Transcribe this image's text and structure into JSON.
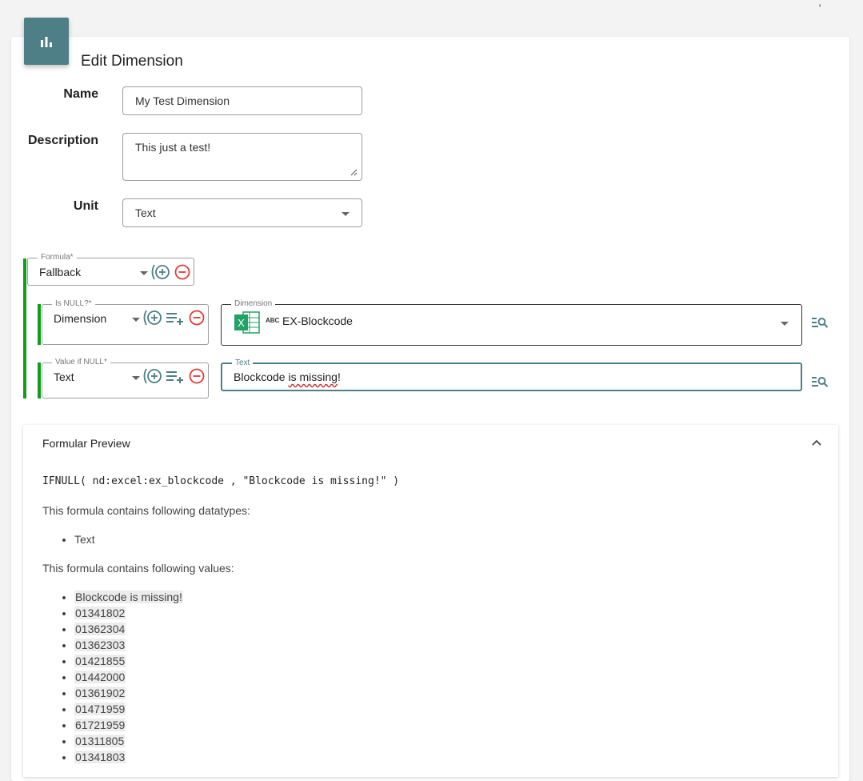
{
  "header": {
    "title": "Edit Dimension"
  },
  "form": {
    "name_label": "Name",
    "name_value": "My Test Dimension",
    "description_label": "Description",
    "description_value": "This just a test!",
    "unit_label": "Unit",
    "unit_value": "Text"
  },
  "formula": {
    "legend": "Formula*",
    "value": "Fallback",
    "isnull": {
      "legend": "Is NULL?*",
      "value": "Dimension",
      "dimension_legend": "Dimension",
      "dimension_type_badge": "ABC",
      "dimension_value": "EX-Blockcode",
      "excel_letter": "X"
    },
    "value_if_null": {
      "legend": "Value if NULL*",
      "value": "Text",
      "text_legend": "Text",
      "text_value": "Blockcode is missing!",
      "text_value_a": "Blockcode ",
      "text_value_b": "is missing",
      "text_value_c": "!"
    }
  },
  "preview": {
    "title": "Formular Preview",
    "code": "IFNULL( nd:excel:ex_blockcode , \"Blockcode is missing!\" )",
    "datatypes_heading": "This formula contains following datatypes:",
    "datatypes": [
      "Text"
    ],
    "values_heading": "This formula contains following values:",
    "values": [
      "Blockcode is missing!",
      "01341802",
      "01362304",
      "01362303",
      "01421855",
      "01442000",
      "01361902",
      "01471959",
      "61721959",
      "01311805",
      "01341803"
    ]
  },
  "colors": {
    "accent": "#4f7f86",
    "green": "#0f9d1b",
    "remove_red": "#e53935",
    "excel_green": "#1e7145"
  }
}
